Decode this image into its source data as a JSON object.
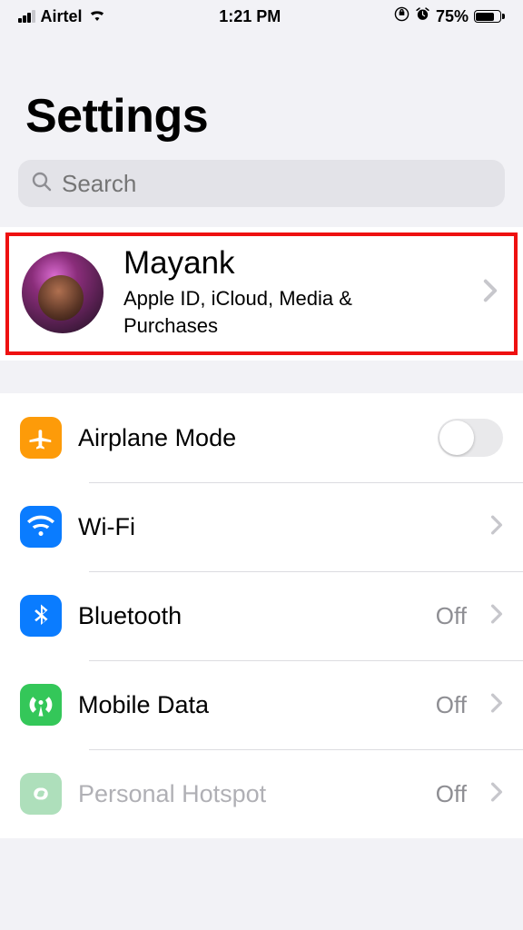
{
  "status": {
    "carrier": "Airtel",
    "time": "1:21 PM",
    "battery_pct": "75%"
  },
  "header": {
    "title": "Settings"
  },
  "search": {
    "placeholder": "Search"
  },
  "apple_id": {
    "name": "Mayank",
    "subtitle": "Apple ID, iCloud, Media & Purchases"
  },
  "rows": {
    "airplane": {
      "label": "Airplane Mode",
      "toggle": false
    },
    "wifi": {
      "label": "Wi-Fi",
      "value": ""
    },
    "bluetooth": {
      "label": "Bluetooth",
      "value": "Off"
    },
    "mobile_data": {
      "label": "Mobile Data",
      "value": "Off"
    },
    "hotspot": {
      "label": "Personal Hotspot",
      "value": "Off"
    }
  }
}
